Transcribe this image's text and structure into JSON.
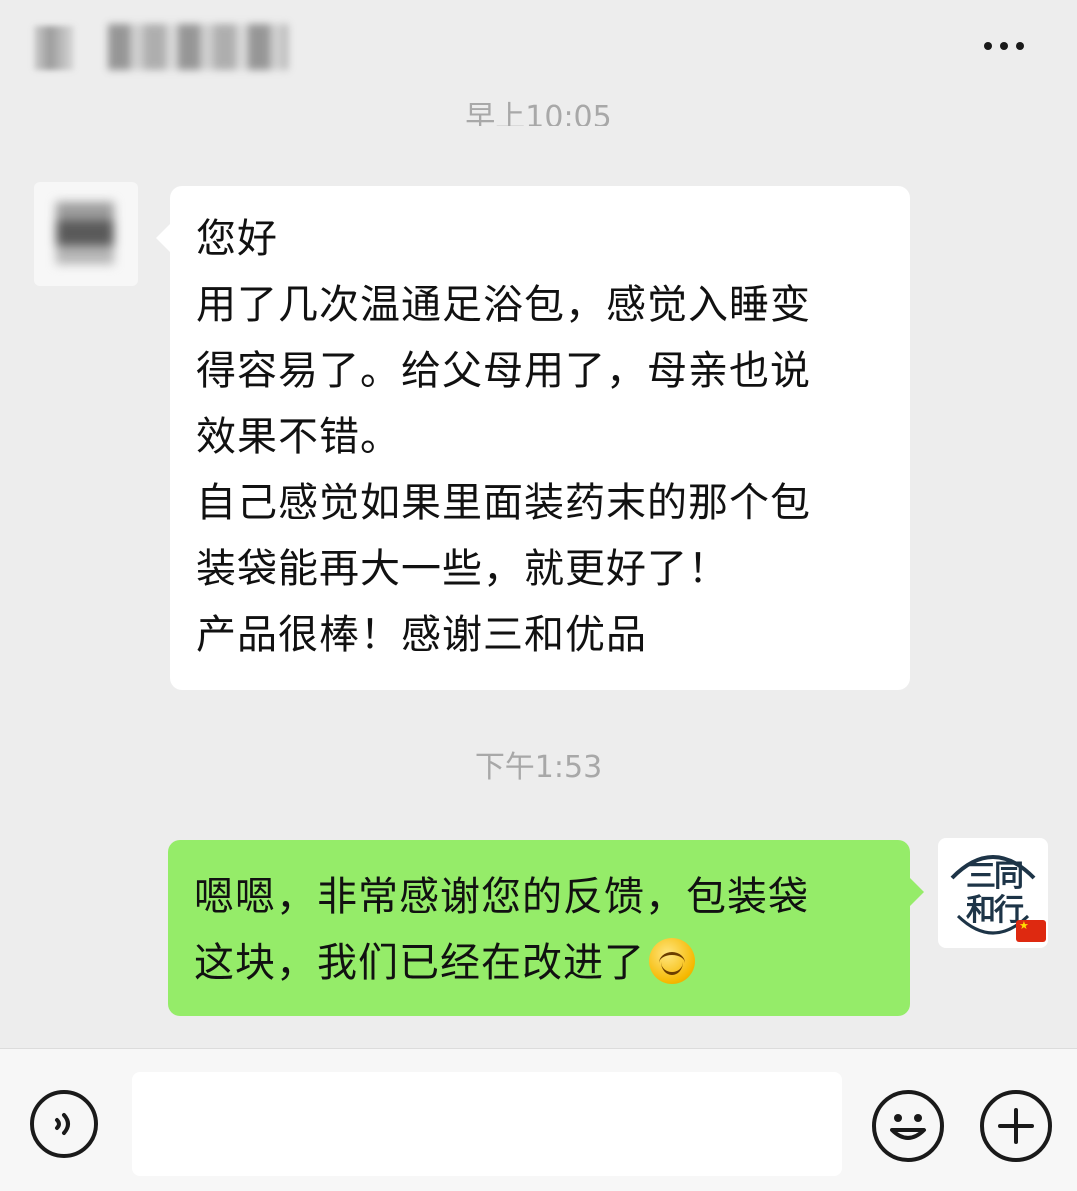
{
  "header": {
    "more_icon": "more-dots-icon"
  },
  "timestamps": {
    "first": "早上10:05",
    "second": "下午1:53"
  },
  "messages": [
    {
      "side": "left",
      "lines": [
        "您好",
        "用了几次温通足浴包，感觉入睡变",
        "得容易了。给父母用了，母亲也说",
        "效果不错。",
        "自己感觉如果里面装药末的那个包",
        "装袋能再大一些，就更好了！",
        "产品很棒！感谢三和优品"
      ]
    },
    {
      "side": "right",
      "lines": [
        "嗯嗯，非常感谢您的反馈，包装袋",
        "这块，我们已经在改进了"
      ],
      "emoji": "blush-smile-emoji"
    }
  ],
  "avatar_right": {
    "logo_line1": "三同",
    "logo_line2": "和行"
  },
  "bottom_bar": {
    "voice_icon": "voice-icon",
    "emoji_icon": "emoji-icon",
    "plus_icon": "plus-icon"
  },
  "colors": {
    "background": "#ededed",
    "bubble_incoming": "#ffffff",
    "bubble_outgoing": "#95ec69",
    "timestamp": "#a8a8a8"
  }
}
